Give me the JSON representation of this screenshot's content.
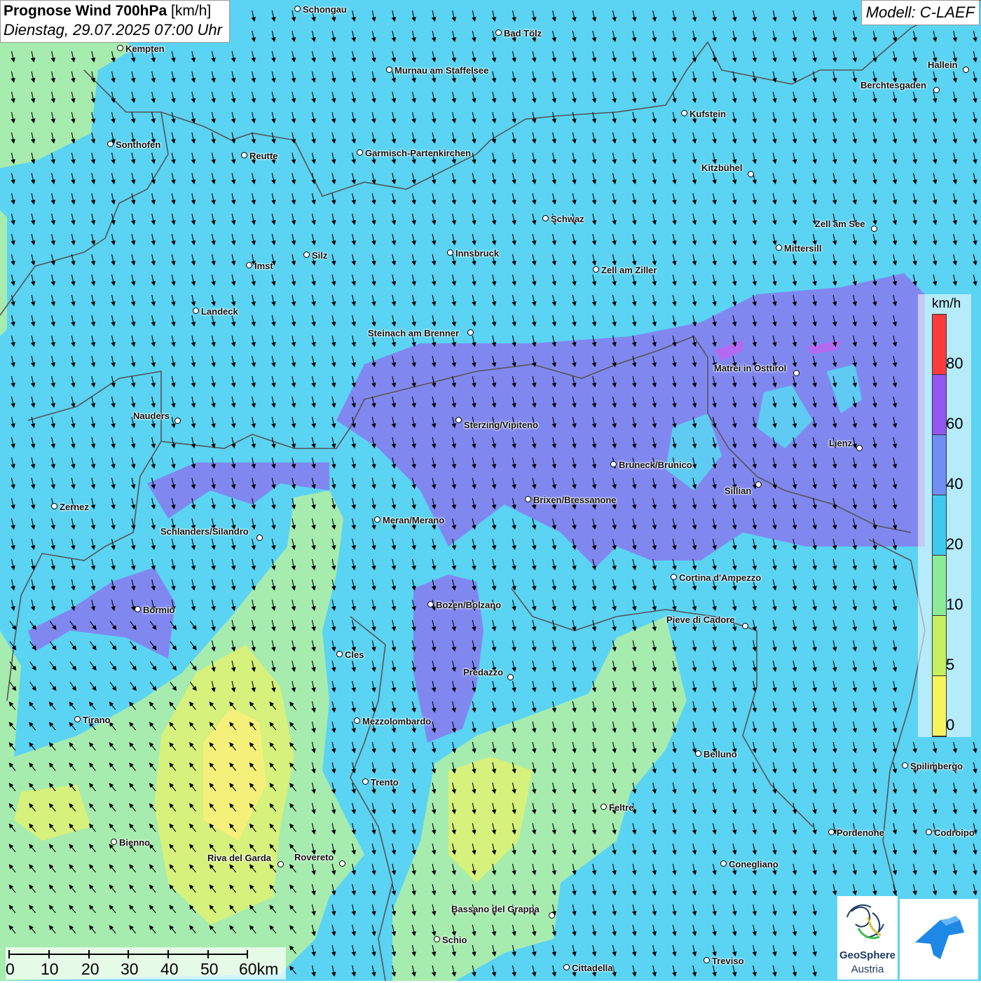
{
  "title": {
    "main": "Prognose Wind 700hPa",
    "unit": "[km/h]",
    "datetime": "Dienstag, 29.07.2025 07:00 Uhr"
  },
  "model": "Modell: C-LAEF",
  "colors": {
    "base": "#5bd3f3",
    "purple": "#8088f0",
    "green": "#a6ecae",
    "yellowgreen": "#d6f17c",
    "yellow": "#f5f07a",
    "border": "#555555"
  },
  "legend": {
    "unit": "km/h",
    "labels": [
      "80",
      "60",
      "40",
      "20",
      "10",
      "5",
      "0"
    ],
    "bands": [
      {
        "from": 80,
        "color": "#ff3b3b"
      },
      {
        "from": 60,
        "color": "#9257f2"
      },
      {
        "from": 40,
        "color": "#6f8ef3"
      },
      {
        "from": 20,
        "color": "#3fc9ef"
      },
      {
        "from": 10,
        "color": "#8ceb97"
      },
      {
        "from": 5,
        "color": "#c6f05f"
      },
      {
        "from": 0,
        "color": "#f6f35e"
      }
    ]
  },
  "scalebar": {
    "labels": [
      "0",
      "10",
      "20",
      "30",
      "40",
      "50",
      "60km"
    ]
  },
  "cities": [
    "Schongau",
    "Bad Tölz",
    "Kempten",
    "Murnau am Staffelsee",
    "Hallein",
    "Berchtesgaden",
    "Kufstein",
    "Sonthofen",
    "Reutte",
    "Garmisch-Partenkirchen",
    "Kitzbühel",
    "Schwaz",
    "Zell am See",
    "Mittersill",
    "Innsbruck",
    "Silz",
    "Imst",
    "Zell am Ziller",
    "Landeck",
    "Steinach am Brenner",
    "Matrei in Osttirol",
    "Nauders",
    "Sterzing/Vipiteno",
    "Lienz",
    "Bruneck/Brunico",
    "Sillian",
    "Brixen/Bressanone",
    "Zernez",
    "Meran/Merano",
    "Schlanders/Silandro",
    "Cortina d'Ampezzo",
    "Bozen/Bolzano",
    "Bormio",
    "Pieve di Cadore",
    "Cles",
    "Predazzo",
    "Tirano",
    "Mezzolombardo",
    "Belluno",
    "Spilimbergo",
    "Trento",
    "Feltre",
    "Pordenone",
    "Codroipo",
    "Bienno",
    "Riva del Garda",
    "Rovereto",
    "Conegliano",
    "Bassano del Grappa",
    "Schio",
    "Treviso",
    "Cittadella"
  ],
  "logos": {
    "geosphere_name": "GeoSphere",
    "geosphere_country": "Austria"
  },
  "wind": {
    "dominant_direction": "north",
    "south_west_rotation": "northeast"
  }
}
